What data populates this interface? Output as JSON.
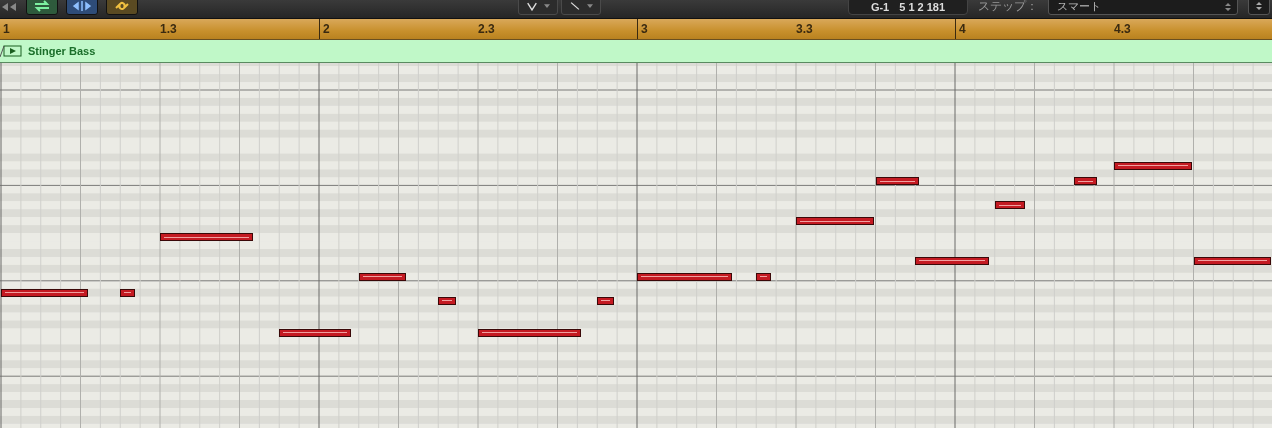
{
  "toolbar": {
    "position_pitch": "G-1",
    "position_value": "5 1 2 181",
    "step_label": "ステップ：",
    "step_mode": "スマート"
  },
  "ruler": {
    "labels": [
      "1",
      "1.3",
      "2",
      "2.3",
      "3",
      "3.3",
      "4",
      "4.3"
    ]
  },
  "region": {
    "name": "Stinger Bass"
  }
}
